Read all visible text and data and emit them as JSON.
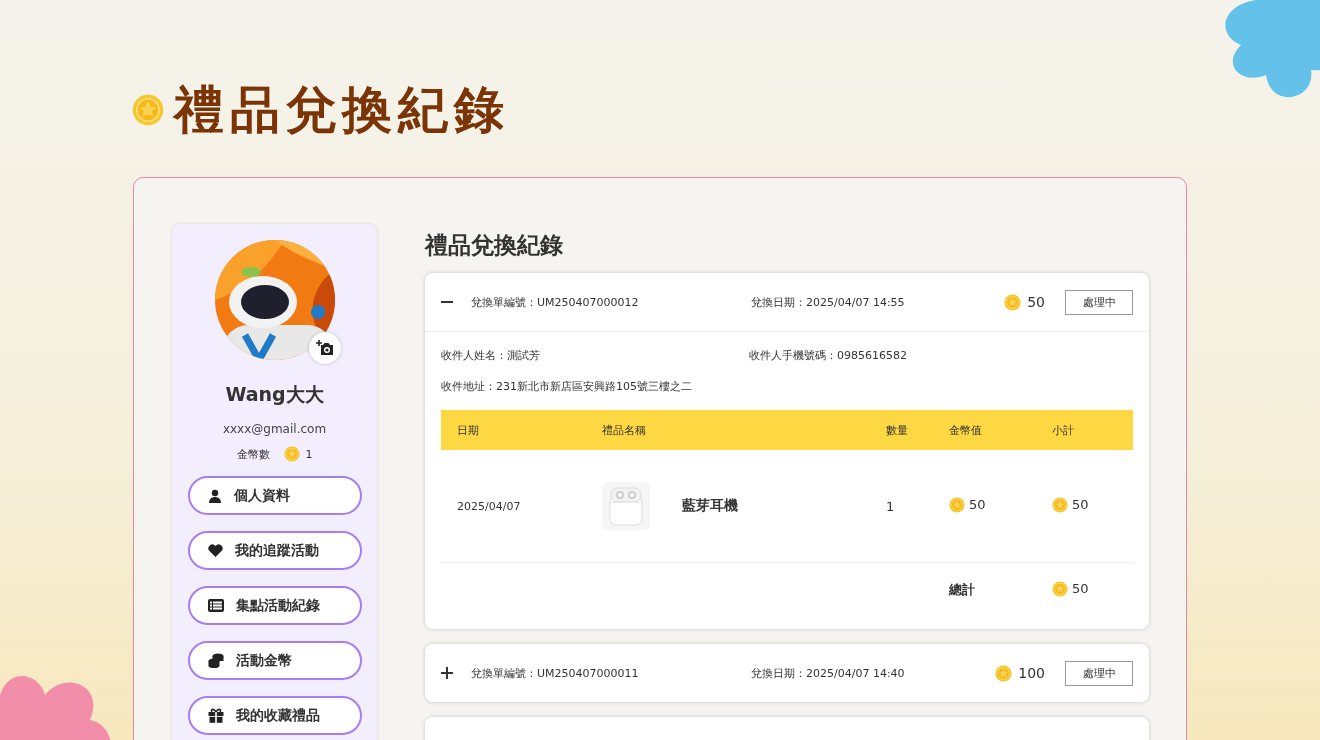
{
  "page_title": "禮品兌換紀錄",
  "profile": {
    "name": "Wang大大",
    "email": "xxxx@gmail.com",
    "coin_label": "金幣數",
    "coins": "1"
  },
  "menu": [
    {
      "kind": "person",
      "label": "個人資料"
    },
    {
      "kind": "heart",
      "label": "我的追蹤活動"
    },
    {
      "kind": "list",
      "label": "集點活動紀錄"
    },
    {
      "kind": "coins",
      "label": "活動金幣"
    },
    {
      "kind": "gift",
      "label": "我的收藏禮品"
    }
  ],
  "section_title": "禮品兌換紀錄",
  "orders": [
    {
      "expanded": true,
      "order_no": "兌換單編號：UM250407000012",
      "date": "兌換日期：2025/04/07 14:55",
      "coins": "50",
      "status": "處理中",
      "recipient": "收件人姓名：測試芳",
      "phone": "收件人手機號碼：0985616582",
      "address": "收件地址：231新北市新店區安興路105號三樓之二",
      "columns": [
        "日期",
        "禮品名稱",
        "數量",
        "金幣值",
        "小計"
      ],
      "items": [
        {
          "date": "2025/04/07",
          "name": "藍芽耳機",
          "qty": "1",
          "value": "50",
          "subtotal": "50"
        }
      ],
      "total_label": "總計",
      "total": "50"
    },
    {
      "expanded": false,
      "order_no": "兌換單編號：UM250407000011",
      "date": "兌換日期：2025/04/07 14:40",
      "coins": "100",
      "status": "處理中"
    }
  ]
}
